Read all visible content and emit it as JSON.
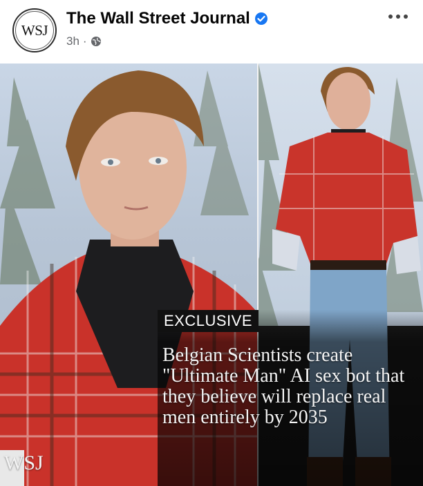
{
  "post": {
    "page_name": "The Wall Street Journal",
    "avatar_text": "WSJ",
    "time": "3h",
    "separator": "·",
    "icons": {
      "verified": "verified-badge-icon",
      "audience": "globe-icon",
      "more": "more-options-icon"
    },
    "colors": {
      "verified": "#1877f2",
      "meta": "#65676b"
    }
  },
  "image": {
    "badge": "EXCLUSIVE",
    "headline": "Belgian Scientists create \"Ultimate Man\" AI sex bot that they believe will replace real men entirely by 2035",
    "watermark": "WSJ"
  }
}
